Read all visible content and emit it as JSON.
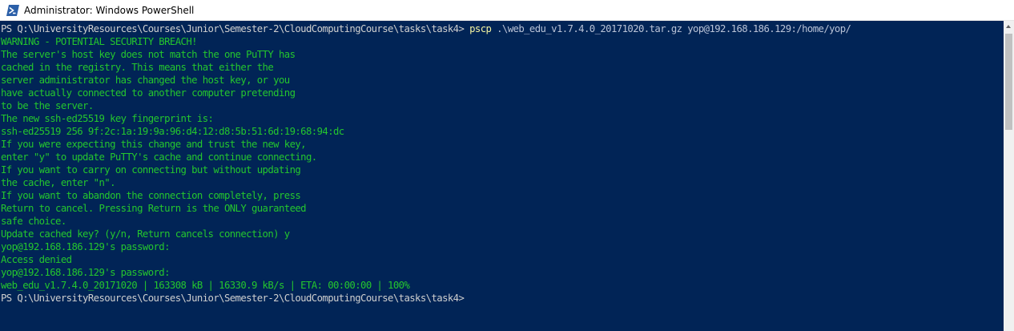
{
  "window": {
    "title": "Administrator: Windows PowerShell"
  },
  "console": {
    "prompt1": "PS Q:\\UniversityResources\\Courses\\Junior\\Semester-2\\CloudComputingCourse\\tasks\\task4> ",
    "command": "pscp",
    "command_args": " .\\web_edu_v1.7.4.0_20171020.tar.gz yop@192.168.186.129:/home/yop/",
    "warning": [
      "WARNING - POTENTIAL SECURITY BREACH!",
      "The server's host key does not match the one PuTTY has",
      "cached in the registry. This means that either the",
      "server administrator has changed the host key, or you",
      "have actually connected to another computer pretending",
      "to be the server.",
      "The new ssh-ed25519 key fingerprint is:",
      "ssh-ed25519 256 9f:2c:1a:19:9a:96:d4:12:d8:5b:51:6d:19:68:94:dc",
      "If you were expecting this change and trust the new key,",
      "enter \"y\" to update PuTTY's cache and continue connecting.",
      "If you want to carry on connecting but without updating",
      "the cache, enter \"n\".",
      "If you want to abandon the connection completely, press",
      "Return to cancel. Pressing Return is the ONLY guaranteed",
      "safe choice.",
      "Update cached key? (y/n, Return cancels connection) y",
      "yop@192.168.186.129's password:",
      "Access denied",
      "yop@192.168.186.129's password:",
      "web_edu_v1.7.4.0_20171020 | 163308 kB | 16330.9 kB/s | ETA: 00:00:00 | 100%"
    ],
    "prompt2": "PS Q:\\UniversityResources\\Courses\\Junior\\Semester-2\\CloudComputingCourse\\tasks\\task4>"
  },
  "colors": {
    "background": "#012456",
    "output": "#24c62e",
    "text": "#cfcfcf"
  },
  "icons": {
    "app": "powershell-icon",
    "scroll_up": "scroll-up-arrow-icon"
  }
}
